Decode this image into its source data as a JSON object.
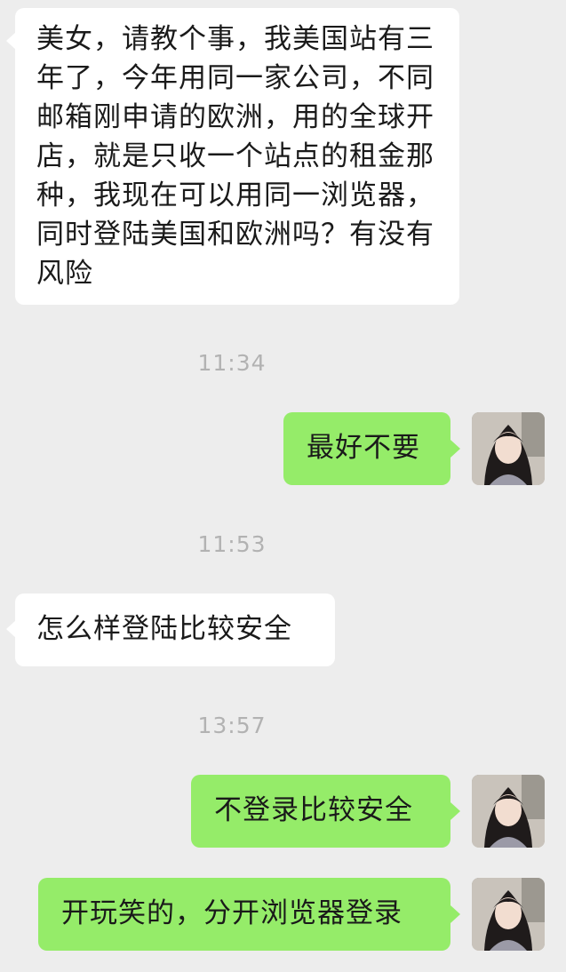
{
  "chat": {
    "messages": [
      {
        "type": "incoming",
        "text": "美女，请教个事，我美国站有三年了，今年用同一家公司，不同邮箱刚申请的欧洲，用的全球开店，就是只收一个站点的租金那种，我现在可以用同一浏览器，同时登陆美国和欧洲吗？有没有风险"
      },
      {
        "type": "time",
        "text": "11:34"
      },
      {
        "type": "outgoing",
        "text": "最好不要"
      },
      {
        "type": "time",
        "text": "11:53"
      },
      {
        "type": "incoming",
        "text": "怎么样登陆比较安全"
      },
      {
        "type": "time",
        "text": "13:57"
      },
      {
        "type": "outgoing",
        "text": "不登录比较安全"
      },
      {
        "type": "outgoing",
        "text": "开玩笑的，分开浏览器登录"
      }
    ]
  },
  "colors": {
    "background": "#ededed",
    "incoming_bubble": "#ffffff",
    "outgoing_bubble": "#95ec69",
    "timestamp": "#b2b2b2",
    "text": "#1a1a1a"
  },
  "icons": {
    "avatar": "user-avatar-photo"
  }
}
